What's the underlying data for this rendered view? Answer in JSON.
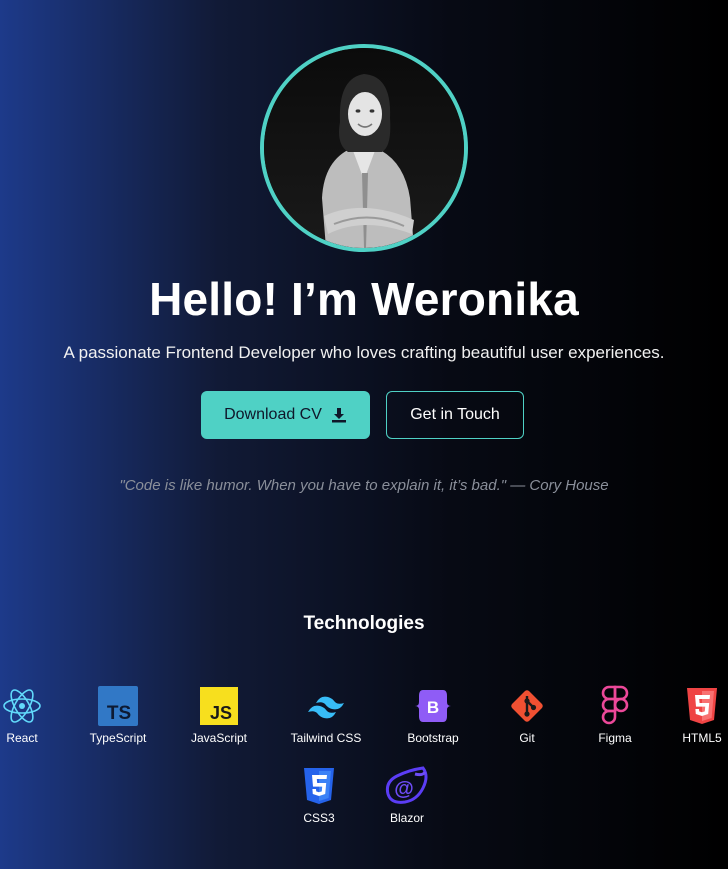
{
  "hero": {
    "title": "Hello! I’m Weronika",
    "subtitle": "A passionate Frontend Developer who loves crafting beautiful user experiences.",
    "quote": "\"Code is like humor. When you have to explain it, it’s bad.\" — Cory House",
    "avatar_icon": "profile-photo"
  },
  "buttons": {
    "download_cv": "Download CV",
    "download_icon": "download-icon",
    "get_in_touch": "Get in Touch"
  },
  "technologies": {
    "heading": "Technologies",
    "items": [
      {
        "label": "React",
        "icon": "react-icon",
        "color": "#61dafb"
      },
      {
        "label": "TypeScript",
        "icon": "typescript-icon",
        "color": "#3178c6"
      },
      {
        "label": "JavaScript",
        "icon": "javascript-icon",
        "color": "#f7df1e"
      },
      {
        "label": "Tailwind CSS",
        "icon": "tailwind-icon",
        "color": "#38bdf8"
      },
      {
        "label": "Bootstrap",
        "icon": "bootstrap-icon",
        "color": "#7952b3"
      },
      {
        "label": "Git",
        "icon": "git-icon",
        "color": "#f05032"
      },
      {
        "label": "Figma",
        "icon": "figma-icon",
        "color": "#f24e1e"
      },
      {
        "label": "HTML5",
        "icon": "html5-icon",
        "color": "#e34f26"
      },
      {
        "label": "CSS3",
        "icon": "css3-icon",
        "color": "#1572b6"
      },
      {
        "label": "Blazor",
        "icon": "blazor-icon",
        "color": "#512bd4"
      }
    ]
  },
  "colors": {
    "accent": "#4fd1c5",
    "background_start": "#1d3a8a",
    "background_end": "#000000"
  }
}
